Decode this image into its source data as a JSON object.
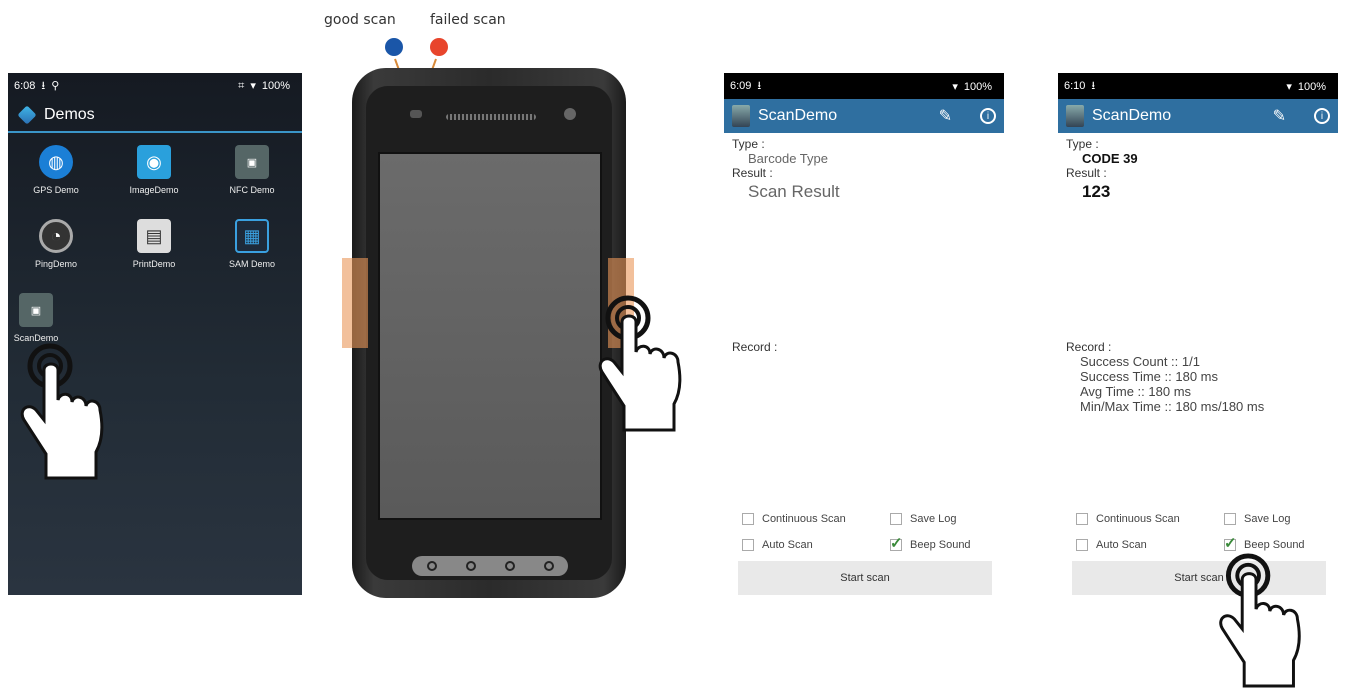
{
  "legend": {
    "good_label": "good scan",
    "failed_label": "failed scan",
    "good_color": "#1a56a8",
    "failed_color": "#e8452c"
  },
  "launcher": {
    "status": {
      "time": "6:08",
      "battery": "100%"
    },
    "app_title": "Demos",
    "apps": [
      {
        "label": "GPS Demo",
        "icon": "globe-icon"
      },
      {
        "label": "ImageDemo",
        "icon": "camera-icon"
      },
      {
        "label": "NFC Demo",
        "icon": "nfc-icon"
      },
      {
        "label": "PingDemo",
        "icon": "gauge-icon"
      },
      {
        "label": "PrintDemo",
        "icon": "printer-icon"
      },
      {
        "label": "SAM Demo",
        "icon": "sim-card-icon"
      },
      {
        "label": "ScanDemo",
        "icon": "scanner-icon"
      }
    ]
  },
  "scan_before": {
    "status": {
      "time": "6:09",
      "battery": "100%"
    },
    "title": "ScanDemo",
    "type_label": "Type :",
    "type_value": "Barcode Type",
    "result_label": "Result :",
    "result_value": "Scan Result",
    "record_label": "Record :",
    "record_lines": [],
    "options": {
      "continuous": "Continuous Scan",
      "save_log": "Save Log",
      "auto": "Auto Scan",
      "beep": "Beep Sound"
    },
    "start_label": "Start scan"
  },
  "scan_after": {
    "status": {
      "time": "6:10",
      "battery": "100%"
    },
    "title": "ScanDemo",
    "type_label": "Type :",
    "type_value": "CODE 39",
    "result_label": "Result :",
    "result_value": "123",
    "record_label": "Record :",
    "record_lines": [
      "Success Count :: 1/1",
      "Success Time :: 180 ms",
      "Avg Time :: 180 ms",
      "Min/Max Time :: 180 ms/180 ms"
    ],
    "options": {
      "continuous": "Continuous Scan",
      "save_log": "Save Log",
      "auto": "Auto Scan",
      "beep": "Beep Sound"
    },
    "start_label": "Start scan"
  }
}
